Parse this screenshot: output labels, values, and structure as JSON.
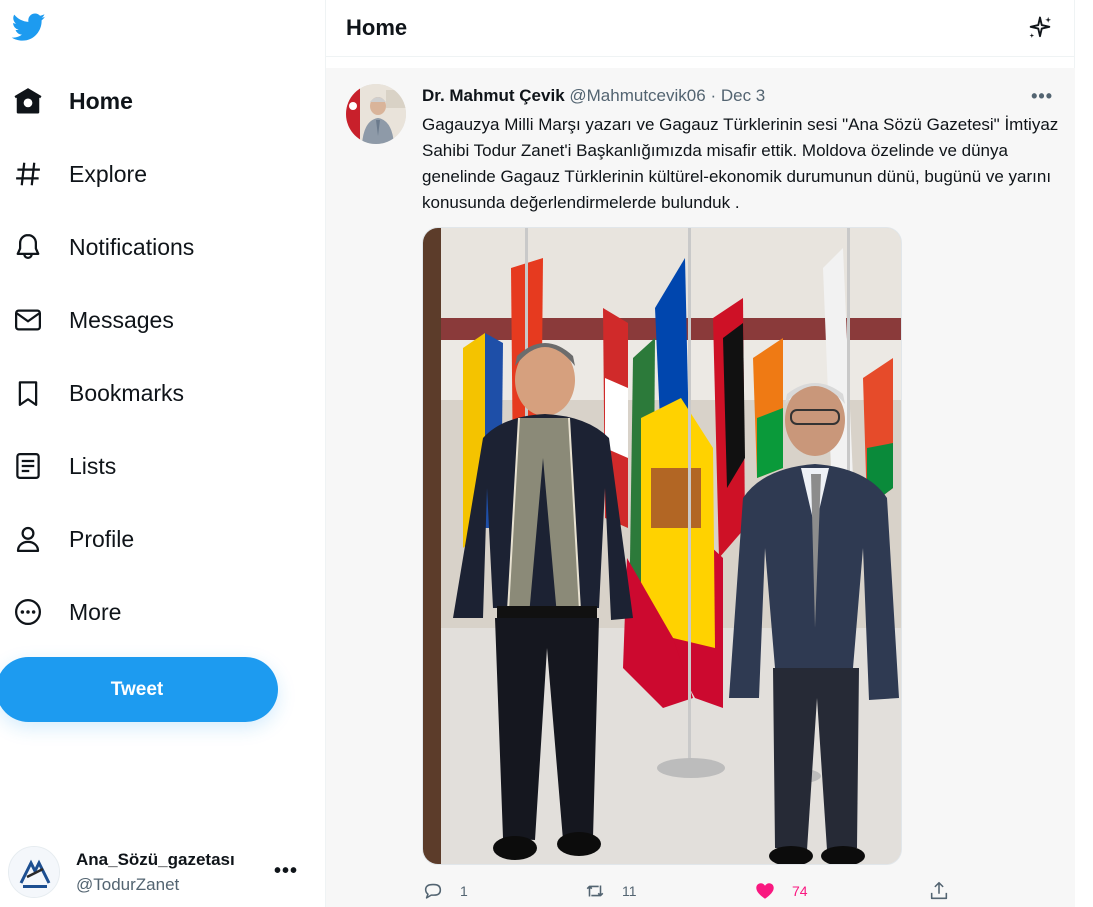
{
  "nav": {
    "items": [
      {
        "label": "Home",
        "icon": "home-icon"
      },
      {
        "label": "Explore",
        "icon": "hashtag-icon"
      },
      {
        "label": "Notifications",
        "icon": "bell-icon"
      },
      {
        "label": "Messages",
        "icon": "envelope-icon"
      },
      {
        "label": "Bookmarks",
        "icon": "bookmark-icon"
      },
      {
        "label": "Lists",
        "icon": "list-icon"
      },
      {
        "label": "Profile",
        "icon": "person-icon"
      },
      {
        "label": "More",
        "icon": "more-circle-icon"
      }
    ],
    "tweet_label": "Tweet"
  },
  "account": {
    "name": "Ana_Sözü_gazetası",
    "handle": "@TodurZanet",
    "more": "•••"
  },
  "header": {
    "title": "Home"
  },
  "tweet": {
    "author": "Dr. Mahmut Çevik",
    "handle": "@Mahmutcevik06",
    "separator": "·",
    "date": "Dec 3",
    "more": "•••",
    "text": "Gagauzya Milli Marşı yazarı ve Gagauz Türklerinin sesi \"Ana Sözü Gazetesi\" İmtiyaz Sahibi Todur Zanet'i Başkanlığımızda misafir ettik. Moldova özelinde ve dünya genelinde Gagauz Türklerinin kültürel-ekonomik durumunun dünü, bugünü ve yarını konusunda değerlendirmelerde bulunduk .",
    "replies": "1",
    "retweets": "11",
    "likes": "74"
  },
  "colors": {
    "brand": "#1d9bf0",
    "like": "#f91880",
    "muted": "#536471"
  }
}
